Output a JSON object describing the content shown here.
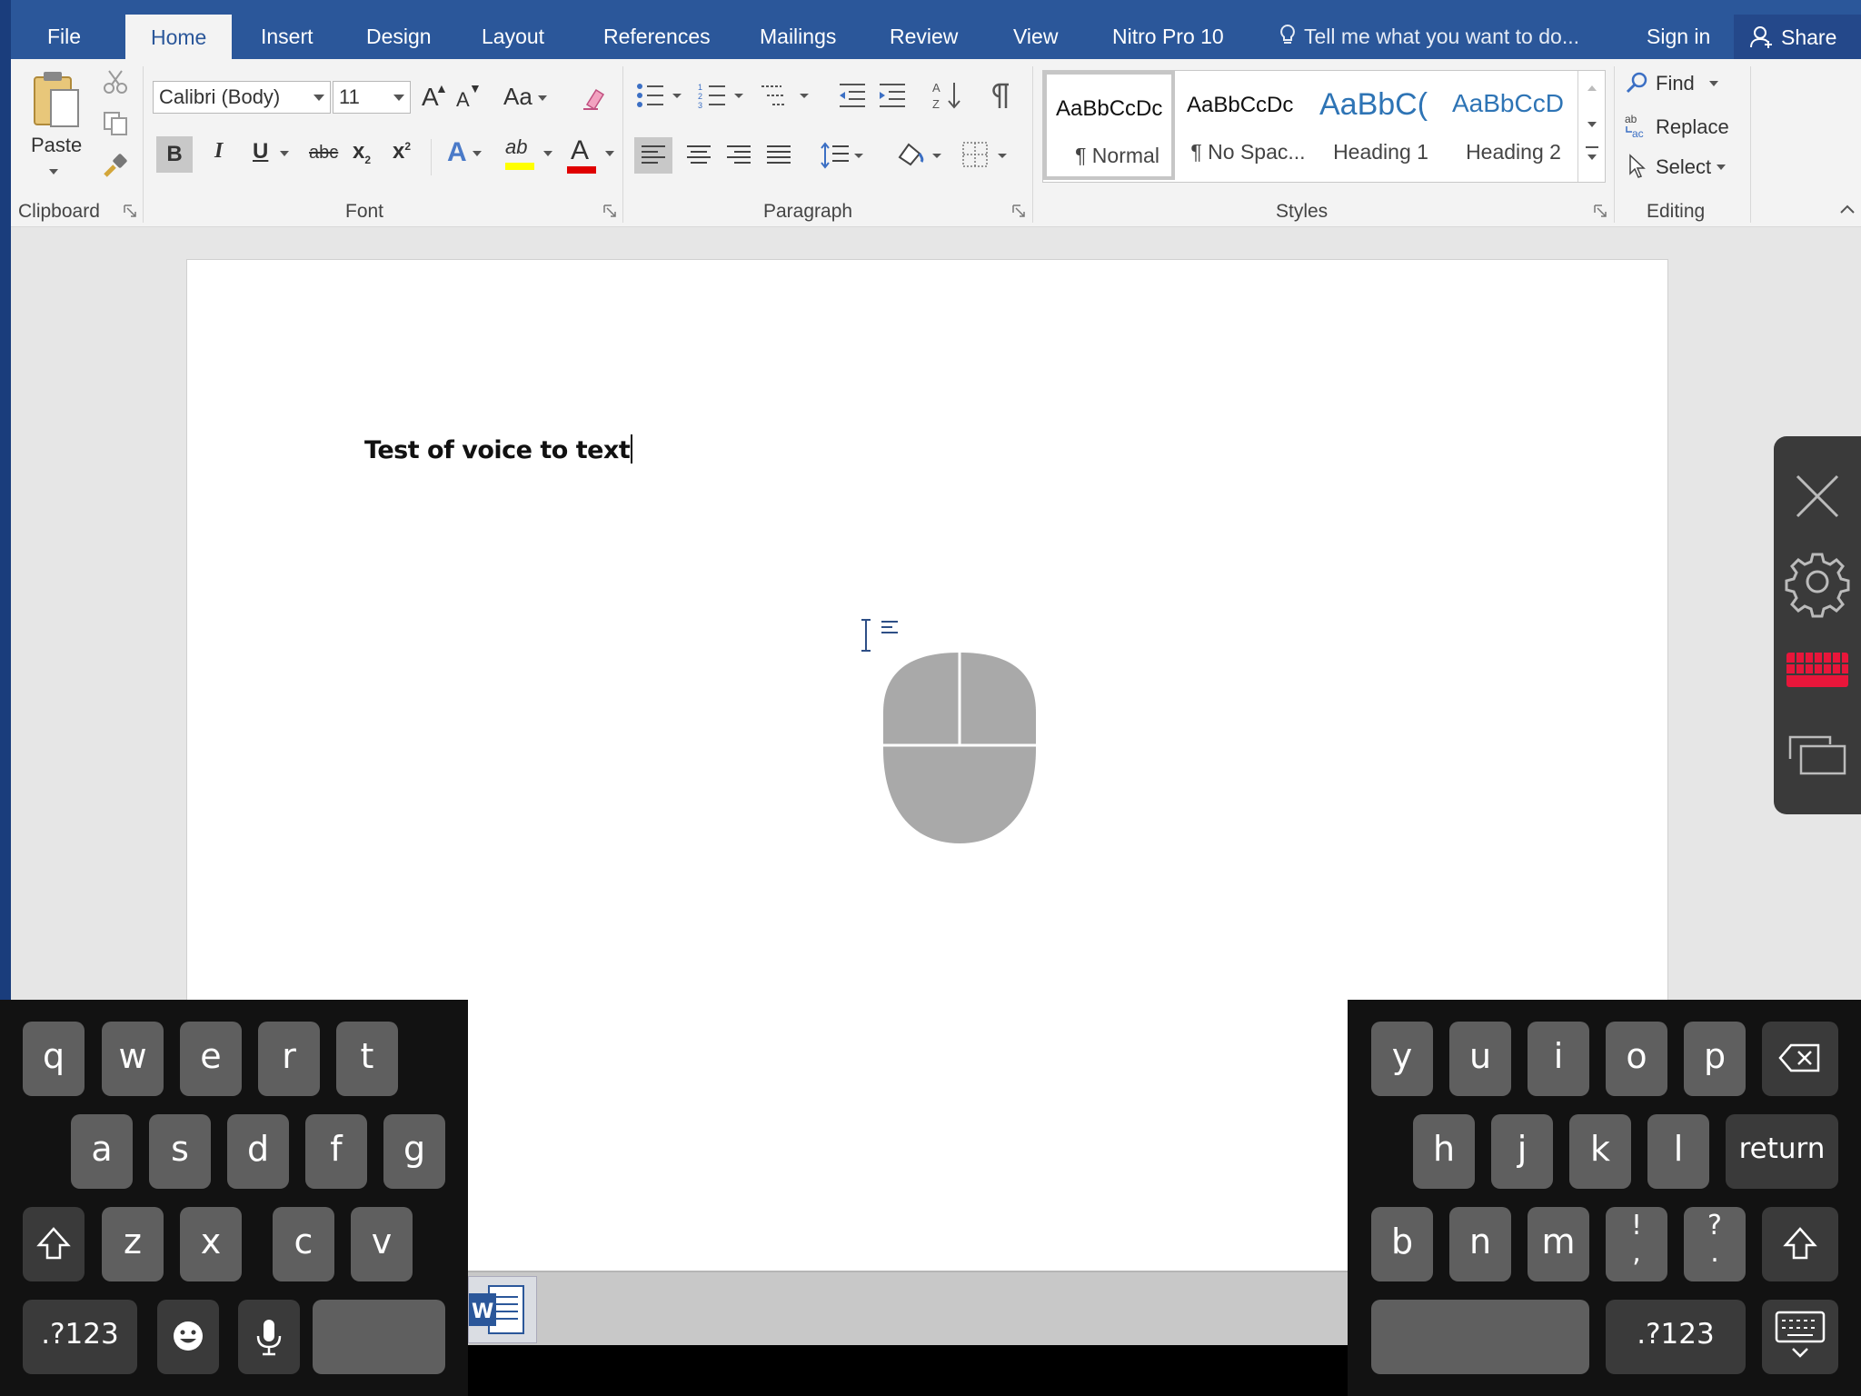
{
  "tabs": {
    "file": "File",
    "home": "Home",
    "insert": "Insert",
    "design": "Design",
    "layout": "Layout",
    "references": "References",
    "mailings": "Mailings",
    "review": "Review",
    "view": "View",
    "nitro": "Nitro Pro 10",
    "tell_me": "Tell me what you want to do...",
    "sign_in": "Sign in",
    "share": "Share"
  },
  "ribbon": {
    "clipboard": {
      "label": "Clipboard",
      "paste": "Paste"
    },
    "font": {
      "label": "Font",
      "font_name": "Calibri (Body)",
      "font_size": "11",
      "grow": "A",
      "shrink": "A",
      "change_case": "Aa",
      "bold": "B",
      "italic": "I",
      "underline": "U",
      "strike": "abc",
      "subscript": "x",
      "superscript": "x",
      "text_effects": "A",
      "highlight": "ab",
      "font_color": "A"
    },
    "paragraph": {
      "label": "Paragraph"
    },
    "styles": {
      "label": "Styles",
      "items": [
        {
          "sample": "AaBbCcDc",
          "name": "¶ Normal"
        },
        {
          "sample": "AaBbCcDc",
          "name": "¶ No Spac..."
        },
        {
          "sample": "AaBbC(",
          "name": "Heading 1"
        },
        {
          "sample": "AaBbCcD",
          "name": "Heading 2"
        }
      ]
    },
    "editing": {
      "label": "Editing",
      "find": "Find",
      "replace": "Replace",
      "select": "Select"
    }
  },
  "document": {
    "text": "Test of voice to text"
  },
  "keyboard": {
    "left_rows": [
      [
        "q",
        "w",
        "e",
        "r",
        "t"
      ],
      [
        "a",
        "s",
        "d",
        "f",
        "g"
      ],
      [
        "z",
        "x",
        "c",
        "v"
      ]
    ],
    "right_rows": [
      [
        "y",
        "u",
        "i",
        "o",
        "p"
      ],
      [
        "h",
        "j",
        "k",
        "l"
      ],
      [
        "b",
        "n",
        "m"
      ]
    ],
    "return": "return",
    "numbers": ".?123",
    "punct1": "!\n,",
    "punct2": "?\n.",
    "excl": "!",
    "comma": ",",
    "quest": "?",
    "period": "."
  },
  "colors": {
    "ribbon_blue": "#2b579a",
    "highlight_yellow": "#ffff00",
    "font_red": "#e00000",
    "keyboard_red": "#e8163a"
  }
}
